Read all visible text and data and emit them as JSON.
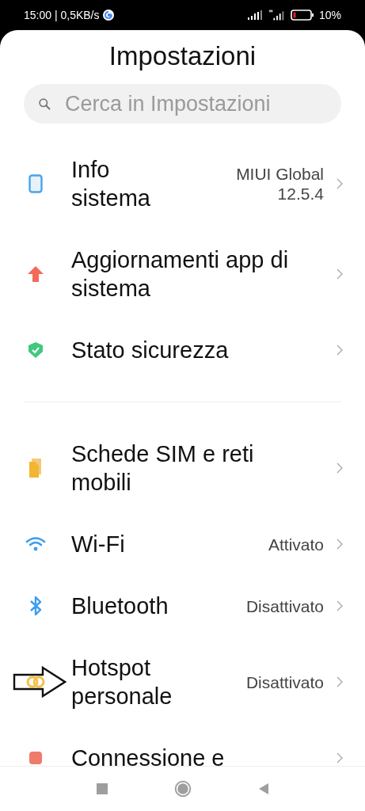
{
  "status_bar": {
    "time": "15:00 | 0,5KB/s",
    "battery": "10%"
  },
  "header": {
    "title": "Impostazioni"
  },
  "search": {
    "placeholder": "Cerca in Impostazioni"
  },
  "sections": [
    {
      "items": [
        {
          "kind": "phone",
          "label": "Info sistema",
          "value": "MIUI Global 12.5.4",
          "highlighted": false
        },
        {
          "kind": "update",
          "label": "Aggiornamenti app di sistema",
          "highlighted": false
        },
        {
          "kind": "shield",
          "label": "Stato sicurezza",
          "highlighted": false
        }
      ]
    },
    {
      "items": [
        {
          "kind": "sim",
          "label": "Schede SIM e reti mobili",
          "highlighted": false
        },
        {
          "kind": "wifi",
          "label": "Wi-Fi",
          "value": "Attivato",
          "highlighted": false
        },
        {
          "kind": "bluetooth",
          "label": "Bluetooth",
          "value": "Disattivato",
          "highlighted": false
        },
        {
          "kind": "hotspot",
          "label": "Hotspot personale",
          "value": "Disattivato",
          "highlighted": true
        },
        {
          "kind": "connection",
          "label": "Connessione e",
          "highlighted": false
        }
      ]
    }
  ]
}
